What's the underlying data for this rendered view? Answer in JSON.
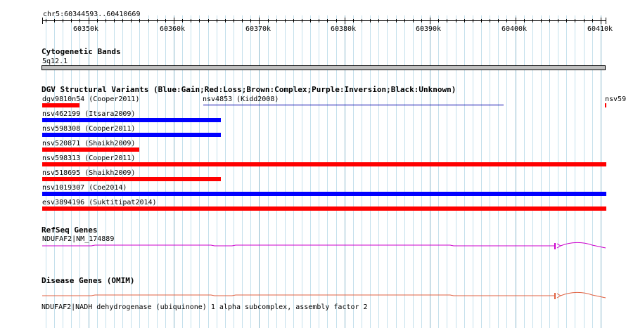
{
  "region": {
    "label": "chr5:60344593..60410669",
    "start": 60344593,
    "end": 60410669
  },
  "ruler_ticks": [
    "60350k",
    "60360k",
    "60370k",
    "60380k",
    "60390k",
    "60400k",
    "60410k"
  ],
  "tracks": {
    "cytoband": {
      "title": "Cytogenetic Bands",
      "band": "5q12.1"
    },
    "dgv": {
      "title": "DGV Structural Variants (Blue:Gain;Red:Loss;Brown:Complex;Purple:Inversion;Black:Unknown)",
      "colors": {
        "gain": "#0000ff",
        "loss": "#ff0000",
        "line": "#0000aa"
      },
      "features": [
        {
          "label": "dgv9810n54 (Cooper2011)",
          "type": "loss",
          "start": 60344593,
          "end": 60349000
        },
        {
          "label": "nsv4853 (Kidd2008)",
          "type": "line",
          "start": 60363500,
          "end": 60398300
        },
        {
          "label": "nsv59",
          "type": "loss",
          "start": 60410500,
          "end": 60410669
        },
        {
          "label": "nsv462199 (Itsara2009)",
          "type": "gain",
          "start": 60344593,
          "end": 60365500
        },
        {
          "label": "nsv598308 (Cooper2011)",
          "type": "gain",
          "start": 60344593,
          "end": 60365500
        },
        {
          "label": "nsv520871 (Shaikh2009)",
          "type": "loss",
          "start": 60344593,
          "end": 60356000
        },
        {
          "label": "nsv598313 (Cooper2011)",
          "type": "loss",
          "start": 60344593,
          "end": 60410669
        },
        {
          "label": "nsv518695 (Shaikh2009)",
          "type": "loss",
          "start": 60344593,
          "end": 60365500
        },
        {
          "label": "nsv1019307 (Coe2014)",
          "type": "gain",
          "start": 60344593,
          "end": 60410669
        },
        {
          "label": "esv3894196 (Suktitipat2014)",
          "type": "loss",
          "start": 60344593,
          "end": 60410669
        }
      ]
    },
    "refseq": {
      "title": "RefSeq Genes",
      "gene": "NDUFAF2|NM_174889",
      "color": "#cc00cc"
    },
    "omim": {
      "title": "Disease Genes (OMIM)",
      "gene": "NDUFAF2|NADH dehydrogenase (ubiquinone) 1 alpha subcomplex, assembly factor 2",
      "color": "#e06040"
    }
  }
}
